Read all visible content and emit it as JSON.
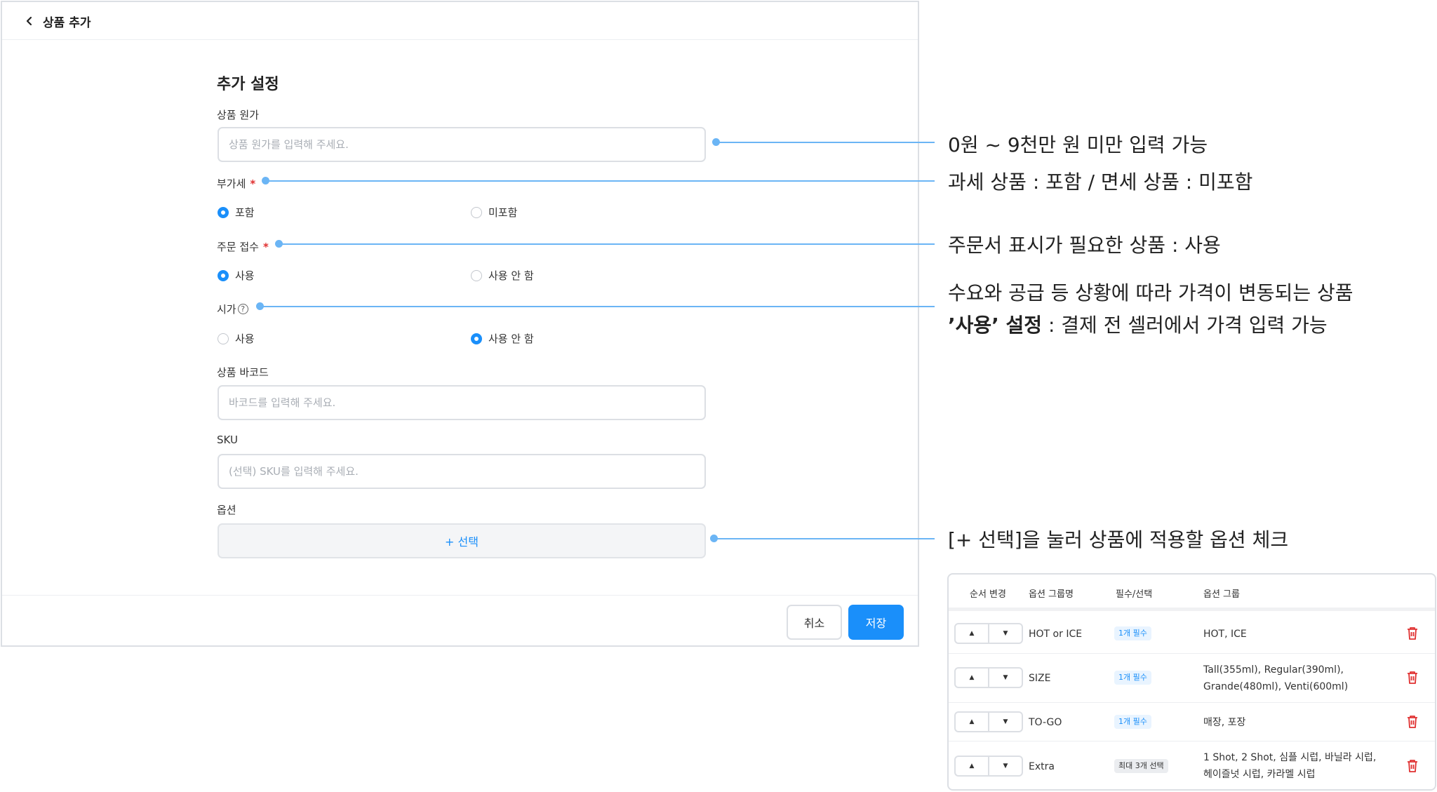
{
  "header": {
    "title": "상품 추가"
  },
  "section": {
    "title": "추가 설정"
  },
  "fields": {
    "price": {
      "label": "상품 원가",
      "placeholder": "상품 원가를 입력해 주세요."
    },
    "vat": {
      "label": "부가세",
      "required": "*",
      "options": [
        "포함",
        "미포함"
      ],
      "selected": "포함"
    },
    "order_receipt": {
      "label": "주문 접수",
      "required": "*",
      "options": [
        "사용",
        "사용 안 함"
      ],
      "selected": "사용"
    },
    "market_price": {
      "label": "시가",
      "help_icon": "?",
      "options": [
        "사용",
        "사용 안 함"
      ],
      "selected": "사용 안 함"
    },
    "barcode": {
      "label": "상품 바코드",
      "placeholder": "바코드를 입력해 주세요."
    },
    "sku": {
      "label": "SKU",
      "placeholder": "(선택) SKU를 입력해 주세요."
    },
    "options": {
      "label": "옵션",
      "select_button": "+ 선택"
    }
  },
  "footer": {
    "cancel_label": "취소",
    "save_label": "저장"
  },
  "annotations": {
    "price": "0원 ~ 9천만 원 미만 입력 가능",
    "vat": "과세 상품 : 포함 / 면세 상품 : 미포함",
    "order_receipt": "주문서 표시가 필요한 상품 : 사용",
    "market_price_line1": "수요와 공급 등 상황에 따라 가격이 변동되는 상품",
    "market_price_line2_bold": "’사용’ 설정",
    "market_price_line2_rest": " : 결제 전 셀러에서 가격 입력 가능",
    "options": "[+ 선택]을 눌러 상품에 적용할 옵션 체크"
  },
  "option_table": {
    "headers": [
      "순서 변경",
      "옵션 그룹명",
      "필수/선택",
      "옵션 그룹"
    ],
    "rows": [
      {
        "name": "HOT or ICE",
        "badge": "1개 필수",
        "badge_type": "required",
        "group_line1": "HOT, ICE",
        "group_line2": ""
      },
      {
        "name": "SIZE",
        "badge": "1개 필수",
        "badge_type": "required",
        "group_line1": "Tall(355ml), Regular(390ml),",
        "group_line2": "Grande(480ml), Venti(600ml)"
      },
      {
        "name": "TO-GO",
        "badge": "1개 필수",
        "badge_type": "required",
        "group_line1": "매장, 포장",
        "group_line2": ""
      },
      {
        "name": "Extra",
        "badge": "최대 3개 선택",
        "badge_type": "max",
        "group_line1": "1 Shot, 2 Shot, 심플 시럽, 바닐라 시럽,",
        "group_line2": "헤이즐넛 시럽, 카라멜 시럽"
      }
    ]
  },
  "colors": {
    "accent": "#1a8ffa",
    "annotation": "#6bb5f5",
    "required": "#e03131",
    "delete": "#e03131"
  },
  "icons": {
    "back": "chevron-left-icon",
    "help": "question-circle-icon",
    "up": "caret-up-icon",
    "down": "caret-down-icon",
    "delete": "trash-icon"
  }
}
